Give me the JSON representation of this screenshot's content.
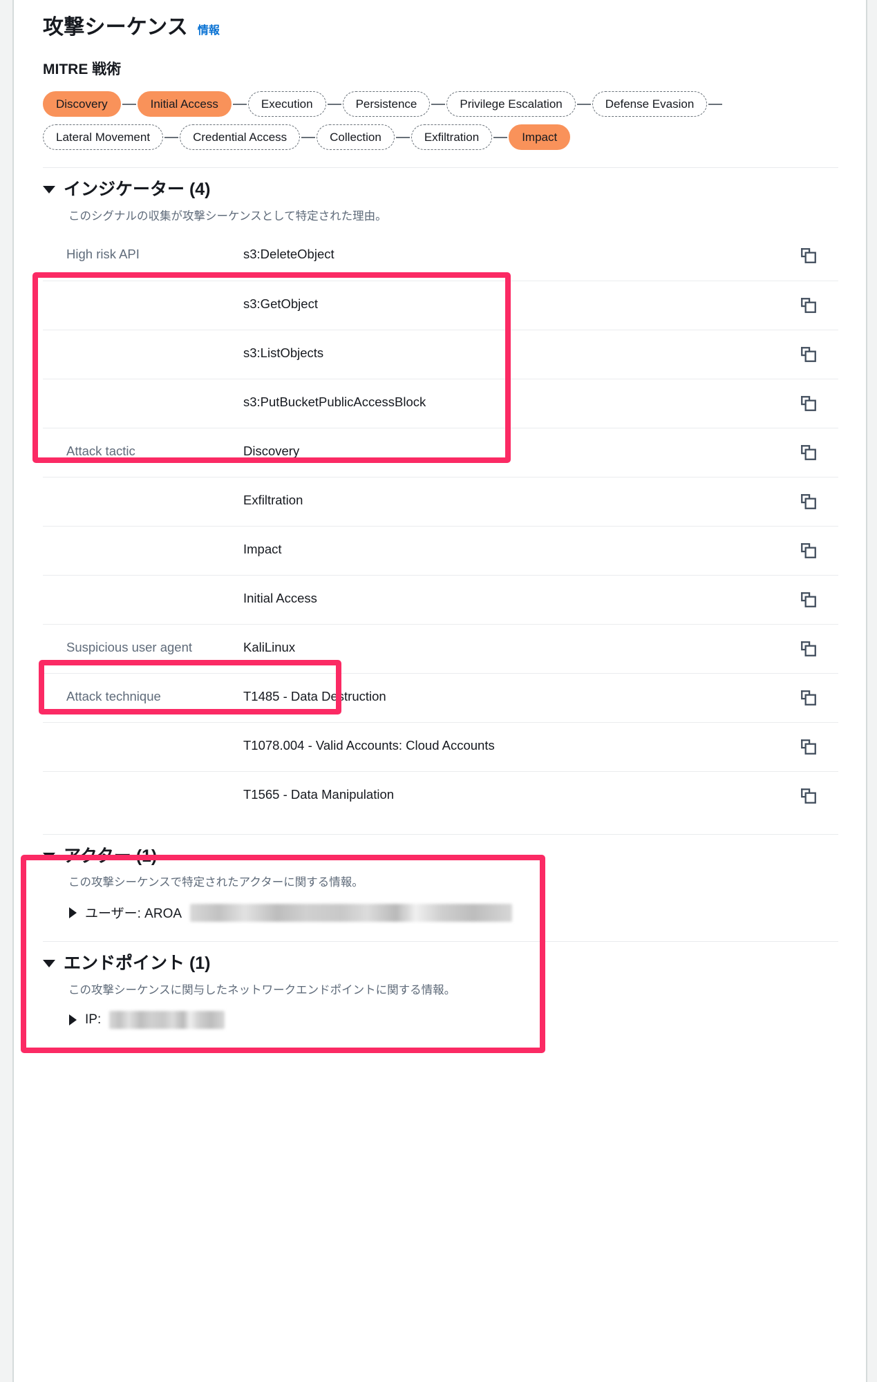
{
  "header": {
    "title": "攻撃シーケンス",
    "info_link": "情報"
  },
  "mitre": {
    "heading": "MITRE 戦術",
    "tactics": [
      {
        "label": "Discovery",
        "active": true
      },
      {
        "label": "Initial Access",
        "active": true
      },
      {
        "label": "Execution",
        "active": false
      },
      {
        "label": "Persistence",
        "active": false
      },
      {
        "label": "Privilege Escalation",
        "active": false
      },
      {
        "label": "Defense Evasion",
        "active": false
      },
      {
        "label": "Lateral Movement",
        "active": false
      },
      {
        "label": "Credential Access",
        "active": false
      },
      {
        "label": "Collection",
        "active": false
      },
      {
        "label": "Exfiltration",
        "active": false
      },
      {
        "label": "Impact",
        "active": true
      }
    ],
    "active_color": "#f9925a",
    "inactive_border_color": "#687078"
  },
  "indicators": {
    "title": "インジケーター (4)",
    "description": "このシグナルの収集が攻撃シーケンスとして特定された理由。",
    "copy_icon": "copy-icon",
    "rows": [
      {
        "label": "High risk API",
        "value": "s3:DeleteObject"
      },
      {
        "label": "",
        "value": "s3:GetObject"
      },
      {
        "label": "",
        "value": "s3:ListObjects"
      },
      {
        "label": "",
        "value": "s3:PutBucketPublicAccessBlock"
      },
      {
        "label": "Attack tactic",
        "value": "Discovery"
      },
      {
        "label": "",
        "value": "Exfiltration"
      },
      {
        "label": "",
        "value": "Impact"
      },
      {
        "label": "",
        "value": "Initial Access"
      },
      {
        "label": "Suspicious user agent",
        "value": "KaliLinux"
      },
      {
        "label": "Attack technique",
        "value": "T1485 - Data Destruction"
      },
      {
        "label": "",
        "value": "T1078.004 - Valid Accounts: Cloud Accounts"
      },
      {
        "label": "",
        "value": "T1565 - Data Manipulation"
      }
    ]
  },
  "actor": {
    "title": "アクター (1)",
    "description": "この攻撃シーケンスで特定されたアクターに関する情報。",
    "item_label": "ユーザー: AROA",
    "item_redacted": true
  },
  "endpoint": {
    "title": "エンドポイント (1)",
    "description": "この攻撃シーケンスに関与したネットワークエンドポイントに関する情報。",
    "item_label": "IP:",
    "item_redacted": true
  },
  "annotations": {
    "color": "#fb2a64",
    "boxes": [
      {
        "name": "high-risk-api-highlight"
      },
      {
        "name": "suspicious-user-agent-highlight"
      },
      {
        "name": "actor-endpoint-highlight"
      }
    ]
  }
}
